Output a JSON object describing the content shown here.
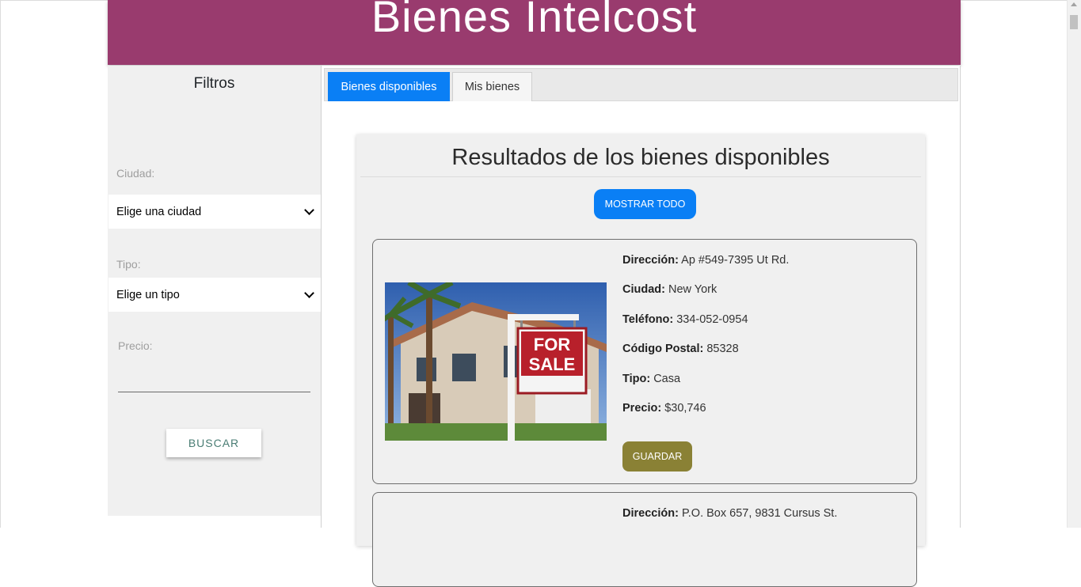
{
  "header": {
    "title": "Bienes Intelcost"
  },
  "sidebar": {
    "title": "Filtros",
    "ciudad_label": "Ciudad:",
    "ciudad_selected": "Elige una ciudad",
    "tipo_label": "Tipo:",
    "tipo_selected": "Elige un tipo",
    "precio_label": "Precio:",
    "buscar_label": "BUSCAR"
  },
  "tabs": [
    {
      "label": "Bienes disponibles",
      "active": true
    },
    {
      "label": "Mis bienes",
      "active": false
    }
  ],
  "results": {
    "title": "Resultados de los bienes disponibles",
    "mostrar_label": "MOSTRAR TODO",
    "listings": [
      {
        "direccion_label": "Dirección:",
        "direccion": "Ap #549-7395 Ut Rd.",
        "ciudad_label": "Ciudad:",
        "ciudad": "New York",
        "telefono_label": "Teléfono:",
        "telefono": "334-052-0954",
        "codigo_label": "Código Postal:",
        "codigo": "85328",
        "tipo_label": "Tipo:",
        "tipo": "Casa",
        "precio_label": "Precio:",
        "precio": "$30,746",
        "guardar_label": "GUARDAR",
        "sign_line1": "FOR",
        "sign_line2": "SALE"
      },
      {
        "direccion_label": "Dirección:",
        "direccion": "P.O. Box 657, 9831 Cursus St."
      }
    ]
  },
  "colors": {
    "header_bg": "#993b6e",
    "primary_blue": "#0a7ff5",
    "guardar_bg": "#8a8135",
    "buscar_text": "#4a7d74"
  }
}
